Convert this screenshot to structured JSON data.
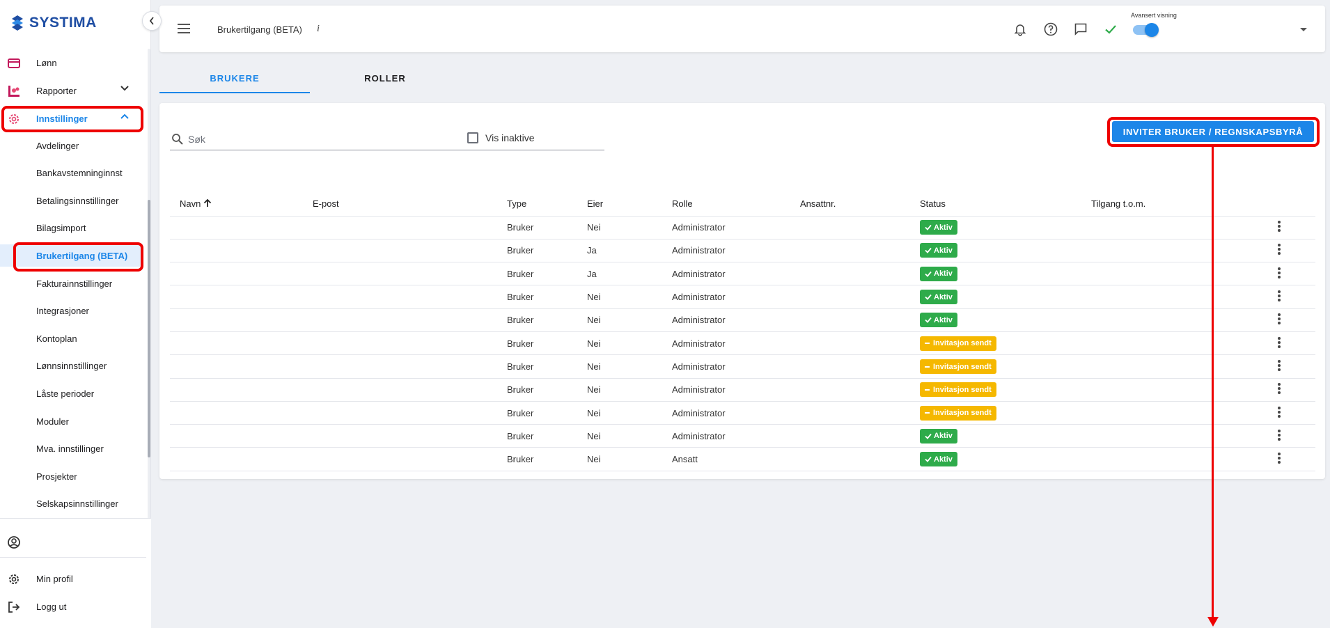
{
  "app": {
    "brand": "SYSTIMA"
  },
  "sidebar": {
    "top_items": [
      {
        "label": "Lønn",
        "icon": "wallet-icon"
      },
      {
        "label": "Rapporter",
        "icon": "reports-icon"
      },
      {
        "label": "Innstillinger",
        "icon": "gear-icon"
      }
    ],
    "sub_items": [
      {
        "label": "Avdelinger"
      },
      {
        "label": "Bankavstemninginnst"
      },
      {
        "label": "Betalingsinnstillinger"
      },
      {
        "label": "Bilagsimport"
      },
      {
        "label": "Brukertilgang (BETA)"
      },
      {
        "label": "Fakturainnstillinger"
      },
      {
        "label": "Integrasjoner"
      },
      {
        "label": "Kontoplan"
      },
      {
        "label": "Lønnsinnstillinger"
      },
      {
        "label": "Låste perioder"
      },
      {
        "label": "Moduler"
      },
      {
        "label": "Mva. innstillinger"
      },
      {
        "label": "Prosjekter"
      },
      {
        "label": "Selskapsinnstillinger"
      }
    ],
    "bottom": {
      "profile_label": "Min profil",
      "logout_label": "Logg ut"
    }
  },
  "header": {
    "title": "Brukertilgang (BETA)",
    "info": "i",
    "advanced_label": "Avansert visning",
    "advanced_enabled": true
  },
  "tabs": [
    {
      "label": "BRUKERE",
      "active": true
    },
    {
      "label": "ROLLER",
      "active": false
    }
  ],
  "toolbar": {
    "search_placeholder": "Søk",
    "show_inactive_label": "Vis inaktive",
    "invite_label": "INVITER BRUKER / REGNSKAPSBYRÅ"
  },
  "table": {
    "columns": [
      "Navn",
      "E-post",
      "Type",
      "Eier",
      "Rolle",
      "Ansattnr.",
      "Status",
      "Tilgang t.o.m."
    ],
    "rows": [
      {
        "type": "Bruker",
        "owner": "Nei",
        "role": "Administrator",
        "status": "Aktiv",
        "status_kind": "active"
      },
      {
        "type": "Bruker",
        "owner": "Ja",
        "role": "Administrator",
        "status": "Aktiv",
        "status_kind": "active"
      },
      {
        "type": "Bruker",
        "owner": "Ja",
        "role": "Administrator",
        "status": "Aktiv",
        "status_kind": "active"
      },
      {
        "type": "Bruker",
        "owner": "Nei",
        "role": "Administrator",
        "status": "Aktiv",
        "status_kind": "active"
      },
      {
        "type": "Bruker",
        "owner": "Nei",
        "role": "Administrator",
        "status": "Aktiv",
        "status_kind": "active"
      },
      {
        "type": "Bruker",
        "owner": "Nei",
        "role": "Administrator",
        "status": "Invitasjon sendt",
        "status_kind": "invited"
      },
      {
        "type": "Bruker",
        "owner": "Nei",
        "role": "Administrator",
        "status": "Invitasjon sendt",
        "status_kind": "invited"
      },
      {
        "type": "Bruker",
        "owner": "Nei",
        "role": "Administrator",
        "status": "Invitasjon sendt",
        "status_kind": "invited"
      },
      {
        "type": "Bruker",
        "owner": "Nei",
        "role": "Administrator",
        "status": "Invitasjon sendt",
        "status_kind": "invited"
      },
      {
        "type": "Bruker",
        "owner": "Nei",
        "role": "Administrator",
        "status": "Aktiv",
        "status_kind": "active"
      },
      {
        "type": "Bruker",
        "owner": "Nei",
        "role": "Ansatt",
        "status": "Aktiv",
        "status_kind": "active"
      }
    ]
  },
  "colors": {
    "accent": "#1c86e8",
    "active_badge": "#2eab4a",
    "invited_badge": "#f5b800",
    "annotation": "#e00000"
  }
}
